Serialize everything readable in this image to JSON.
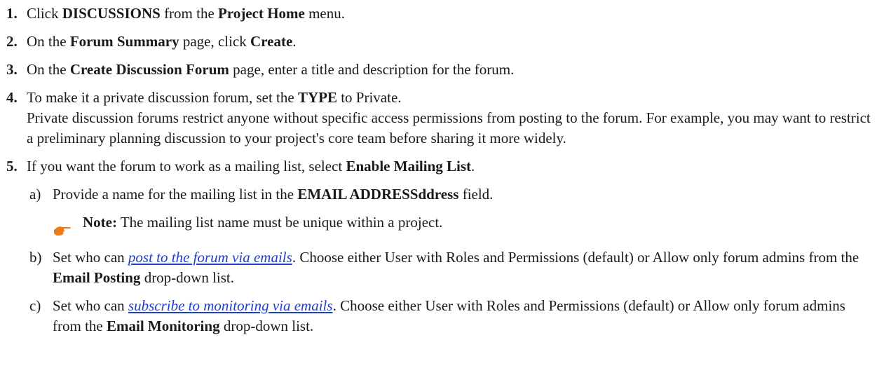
{
  "steps": [
    {
      "number": "1.",
      "parts": [
        "Click ",
        "DISCUSSIONS",
        " from the ",
        "Project Home",
        " menu."
      ]
    },
    {
      "number": "2.",
      "parts": [
        "On the ",
        "Forum Summary",
        " page, click ",
        "Create",
        "."
      ]
    },
    {
      "number": "3.",
      "parts": [
        "On the ",
        "Create Discussion Forum",
        " page, enter a title and description for the forum."
      ]
    },
    {
      "number": "4.",
      "parts": [
        "To make it a private discussion forum, set the ",
        "TYPE",
        " to Private."
      ],
      "detail": "Private discussion forums restrict anyone without specific access permissions from posting to the forum. For example, you may want to restrict a preliminary planning discussion to your project's core team before sharing it more widely."
    },
    {
      "number": "5.",
      "parts": [
        "If you want the forum to work as a mailing list, select ",
        "Enable Mailing List",
        "."
      ]
    }
  ],
  "substeps": {
    "a": {
      "label": "a)",
      "parts": [
        "Provide a name for the mailing list in the ",
        "EMAIL ADDRESSddress",
        " field."
      ]
    },
    "b": {
      "label": "b)",
      "parts": [
        "Set who can ",
        "post to the forum via emails",
        ". Choose either User with Roles and Permissions (default) or Allow only forum admins from the ",
        "Email Posting",
        " drop-down list."
      ]
    },
    "c": {
      "label": "c)",
      "parts": [
        "Set who can ",
        "subscribe to monitoring via emails",
        ". Choose either User with Roles and Permissions (default) or Allow only forum admins from the ",
        "Email Monitoring",
        " drop-down list."
      ]
    }
  },
  "note": {
    "label": "Note:",
    "text": " The mailing list name must be unique within a project.",
    "icon": "pointing-hand-icon"
  },
  "colors": {
    "link": "#1f3fcf",
    "icon": "#f07a1a"
  }
}
